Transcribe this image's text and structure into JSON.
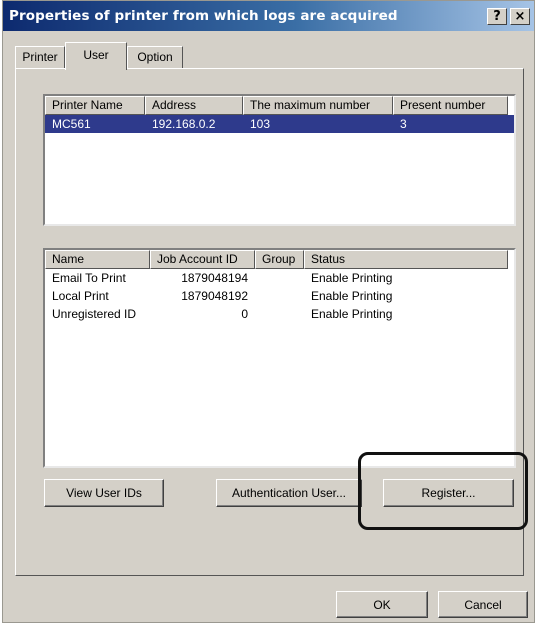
{
  "window": {
    "title": "Properties of printer from which logs are acquired",
    "help_label": "?",
    "close_label": "×"
  },
  "tabs": [
    {
      "label": "Printer",
      "active": false
    },
    {
      "label": "User",
      "active": true
    },
    {
      "label": "Option",
      "active": false
    }
  ],
  "printer_list": {
    "columns": [
      "Printer Name",
      "Address",
      "The maximum number",
      "Present number"
    ],
    "rows": [
      {
        "name": "MC561",
        "address": "192.168.0.2",
        "max": "103",
        "present": "3"
      }
    ]
  },
  "user_list": {
    "columns": [
      "Name",
      "Job Account ID",
      "Group",
      "Status"
    ],
    "rows": [
      {
        "name": "Email To Print",
        "job_id": "1879048194",
        "group": "",
        "status": "Enable Printing"
      },
      {
        "name": "Local Print",
        "job_id": "1879048192",
        "group": "",
        "status": "Enable Printing"
      },
      {
        "name": "Unregistered ID",
        "job_id": "0",
        "group": "",
        "status": "Enable Printing"
      }
    ]
  },
  "buttons": {
    "view_user_ids": "View User IDs",
    "authentication_user": "Authentication User...",
    "register": "Register...",
    "ok": "OK",
    "cancel": "Cancel"
  }
}
